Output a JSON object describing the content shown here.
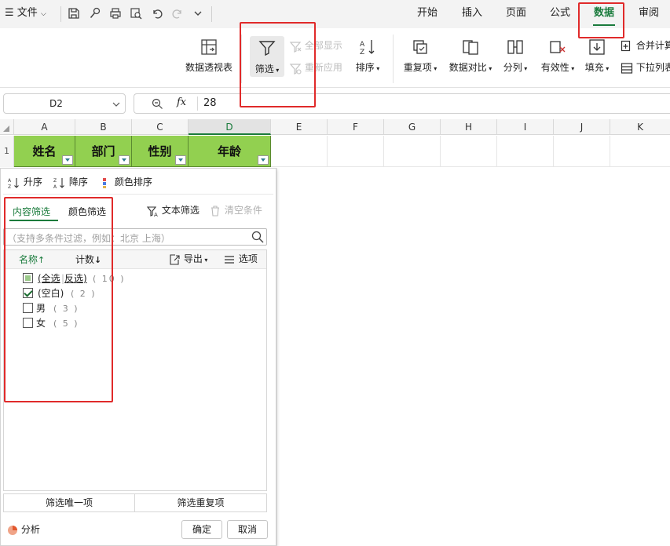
{
  "menubar": {
    "file_label": "文件",
    "tabs": [
      {
        "label": "开始"
      },
      {
        "label": "插入"
      },
      {
        "label": "页面"
      },
      {
        "label": "公式"
      },
      {
        "label": "数据",
        "active": true
      },
      {
        "label": "审阅"
      }
    ]
  },
  "ribbon": {
    "pivot": "数据透视表",
    "filter": "筛选",
    "show_all": "全部显示",
    "reapply": "重新应用",
    "sort": "排序",
    "duplicates": "重复项",
    "compare": "数据对比",
    "split": "分列",
    "validity": "有效性",
    "fill": "填充",
    "consolidate": "合并计算",
    "dropdown_list": "下拉列表"
  },
  "formula_bar": {
    "cell_ref": "D2",
    "fx": "fx",
    "value": "28"
  },
  "sheet": {
    "columns": [
      "A",
      "B",
      "C",
      "D",
      "E",
      "F",
      "G",
      "H",
      "I",
      "J",
      "K"
    ],
    "selected_column": "D",
    "row_number": "1",
    "headers": [
      "姓名",
      "部门",
      "性别",
      "年龄"
    ],
    "header_fill": "#92d050"
  },
  "filter_panel": {
    "sort_asc": "升序",
    "sort_desc": "降序",
    "color_sort": "颜色排序",
    "tab_content": "内容筛选",
    "tab_color": "颜色筛选",
    "text_filter": "文本筛选",
    "clear": "清空条件",
    "search_placeholder": "（支持多条件过滤，例如：北京  上海）",
    "col_name": "名称",
    "col_count": "计数",
    "export": "导出",
    "options": "选项",
    "items": [
      {
        "label": "(全选",
        "label2": "反选)",
        "count": "( 10 )",
        "state": "partial"
      },
      {
        "label": "(空白)",
        "count": "( 2 )",
        "state": "checked"
      },
      {
        "label": "男",
        "count": "( 3 )",
        "state": "unchecked"
      },
      {
        "label": "女",
        "count": "( 5 )",
        "state": "unchecked"
      }
    ],
    "unique": "筛选唯一项",
    "repeat": "筛选重复项",
    "analyze": "分析",
    "ok": "确定",
    "cancel": "取消"
  },
  "colors": {
    "accent": "#1a7b3c",
    "highlight_box": "#e02a2a"
  }
}
